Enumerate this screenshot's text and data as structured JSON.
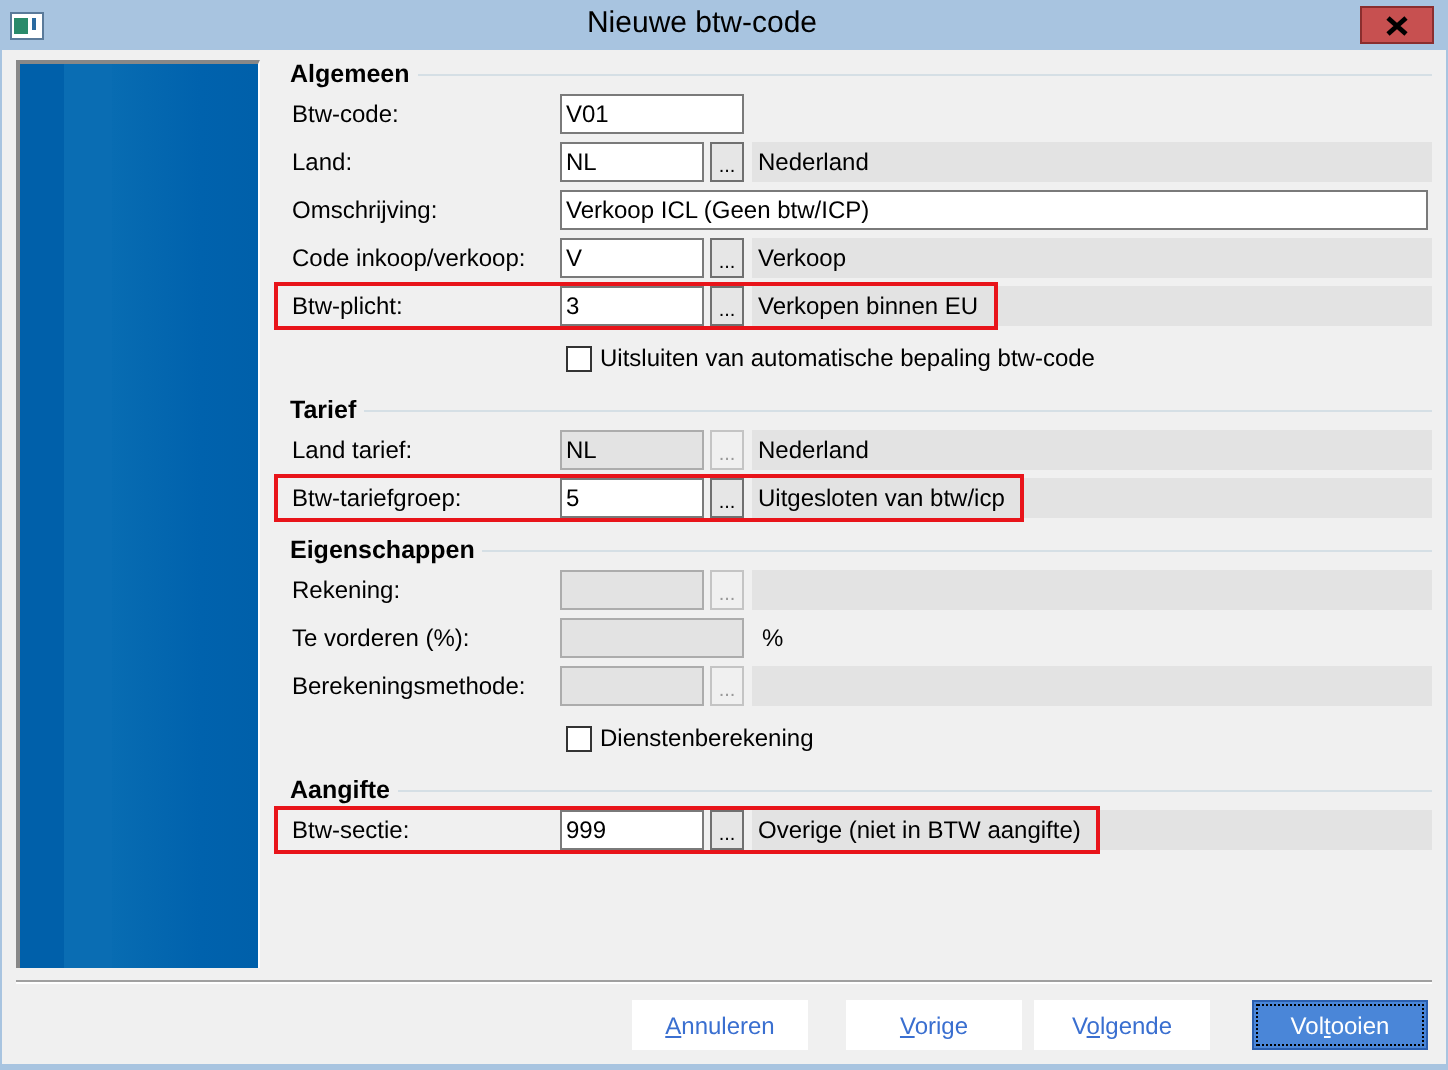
{
  "window": {
    "title": "Nieuwe btw-code"
  },
  "sections": [
    {
      "title": "Algemeen",
      "rows": [
        {
          "kind": "text",
          "label": "Btw-code:",
          "value": "V01",
          "disabled": false,
          "highlighted": false
        },
        {
          "kind": "lookup",
          "label": "Land:",
          "value": "NL",
          "lookup_button": "...",
          "description": "Nederland",
          "disabled": false,
          "highlighted": false
        },
        {
          "kind": "wide",
          "label": "Omschrijving:",
          "value": "Verkoop ICL (Geen btw/ICP)",
          "disabled": false,
          "highlighted": false
        },
        {
          "kind": "lookup",
          "label": "Code inkoop/verkoop:",
          "value": "V",
          "lookup_button": "...",
          "description": "Verkoop",
          "disabled": false,
          "highlighted": false
        },
        {
          "kind": "lookup",
          "label": "Btw-plicht:",
          "value": "3",
          "lookup_button": "...",
          "description": "Verkopen binnen EU",
          "disabled": false,
          "highlighted": true
        },
        {
          "kind": "checkbox",
          "label": "Uitsluiten van automatische bepaling btw-code",
          "checked": false
        }
      ]
    },
    {
      "title": "Tarief",
      "rows": [
        {
          "kind": "lookup",
          "label": "Land tarief:",
          "value": "NL",
          "lookup_button": "...",
          "description": "Nederland",
          "disabled": true,
          "highlighted": false
        },
        {
          "kind": "lookup",
          "label": "Btw-tariefgroep:",
          "value": "5",
          "lookup_button": "...",
          "description": "Uitgesloten van btw/icp",
          "disabled": false,
          "highlighted": true
        }
      ]
    },
    {
      "title": "Eigenschappen",
      "rows": [
        {
          "kind": "lookup",
          "label": "Rekening:",
          "lookup_button": "...",
          "disabled": true,
          "highlighted": false
        },
        {
          "kind": "percent",
          "label": "Te vorderen (%):",
          "unit": "%",
          "disabled": true,
          "highlighted": false
        },
        {
          "kind": "lookup",
          "label": "Berekeningsmethode:",
          "lookup_button": "...",
          "disabled": true,
          "highlighted": false
        },
        {
          "kind": "checkbox",
          "label": "Dienstenberekening",
          "checked": false
        }
      ]
    },
    {
      "title": "Aangifte",
      "rows": [
        {
          "kind": "lookup",
          "label": "Btw-sectie:",
          "value": "999",
          "lookup_button": "...",
          "description": "Overige (niet in BTW aangifte)",
          "disabled": false,
          "highlighted": true
        }
      ]
    }
  ],
  "buttons": [
    {
      "access_key": "A",
      "text_after": "nnuleren",
      "default": false
    },
    {
      "access_key": "V",
      "text_after": "orige",
      "default": false
    },
    {
      "text_before": "V",
      "access_key": "o",
      "text_after": "lgende",
      "default": false
    },
    {
      "text_before": "Vol",
      "access_key": "t",
      "text_after": "ooien",
      "default": true
    }
  ]
}
